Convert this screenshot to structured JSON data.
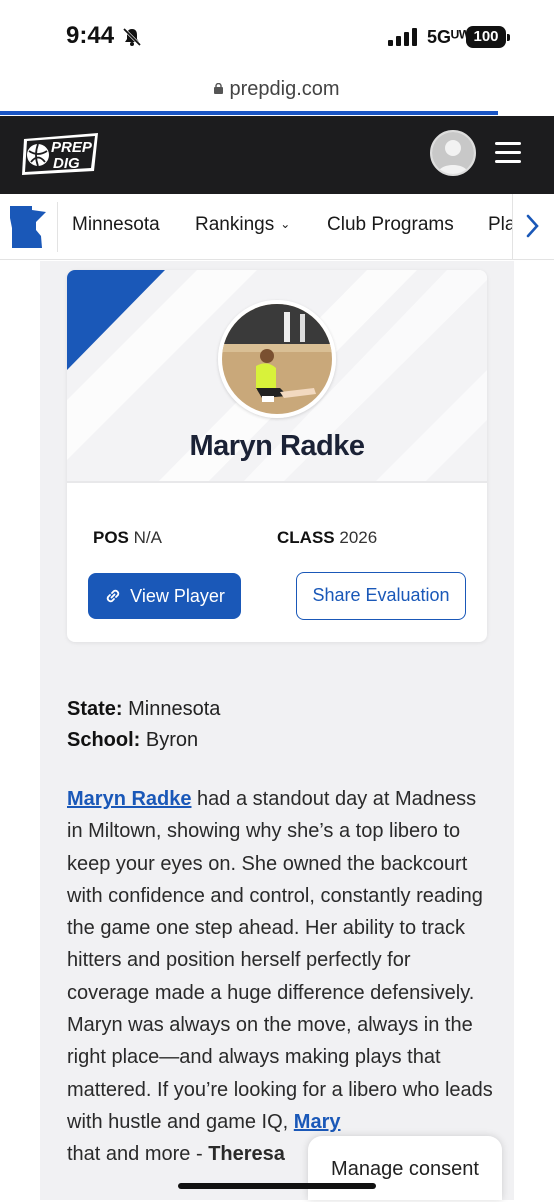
{
  "status": {
    "time": "9:44",
    "network": "5Gᵁᵂ",
    "battery": "100"
  },
  "browser": {
    "url": "prepdig.com"
  },
  "header": {
    "logo_text_1": "PREP",
    "logo_text_2": "DIG"
  },
  "subnav": {
    "items": [
      {
        "label": "Minnesota"
      },
      {
        "label": "Rankings"
      },
      {
        "label": "Club Programs"
      },
      {
        "label": "Pla"
      }
    ]
  },
  "player": {
    "name": "Maryn Radke",
    "pos_label": "POS",
    "pos_value": "N/A",
    "class_label": "CLASS",
    "class_value": "2026",
    "view_button": "View Player",
    "share_button": "Share Evaluation"
  },
  "info": {
    "state_label": "State:",
    "state_value": "Minnesota",
    "school_label": "School:",
    "school_value": "Byron"
  },
  "article": {
    "link_name": "Maryn Radke",
    "body": " had a standout day at Madness in Miltown, showing why she’s a top libero to keep your eyes on. She owned the backcourt with confidence and control, constantly reading the game one step ahead. Her ability to track hitters and position herself perfectly for coverage made a huge difference defensively. Maryn was always on the move, always in the right place—and always making plays that mattered. If you’re looking for a libero who leads with hustle and game IQ, ",
    "link_name_2": "Mary",
    "tail": "that and more - ",
    "author": "Theresa"
  },
  "consent": {
    "label": "Manage consent"
  },
  "colors": {
    "brand_blue": "#1a58b8",
    "header_bg": "#1c1c1e"
  }
}
